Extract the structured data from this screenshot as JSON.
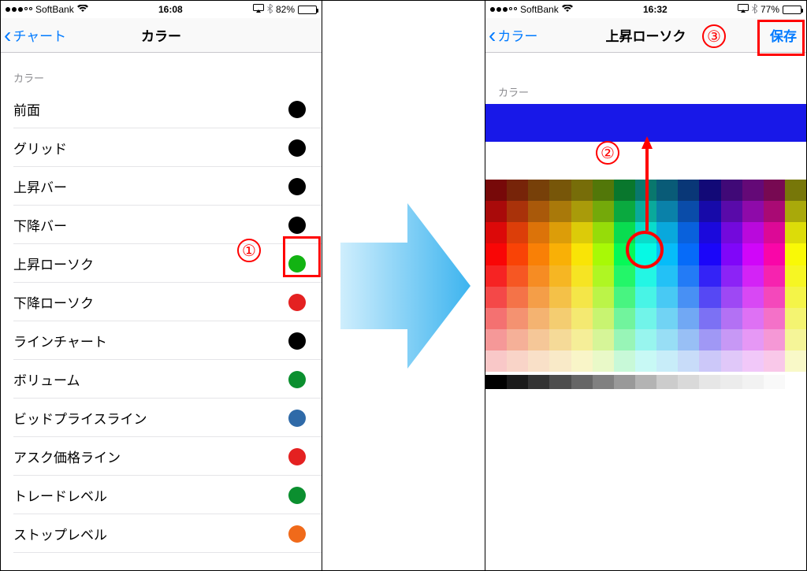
{
  "left": {
    "status": {
      "carrier": "SoftBank",
      "time": "16:08",
      "battery_pct": "82%"
    },
    "nav": {
      "back": "チャート",
      "title": "カラー"
    },
    "section": "カラー",
    "rows": [
      {
        "label": "前面",
        "color": "#000000"
      },
      {
        "label": "グリッド",
        "color": "#000000"
      },
      {
        "label": "上昇バー",
        "color": "#000000"
      },
      {
        "label": "下降バー",
        "color": "#000000"
      },
      {
        "label": "上昇ローソク",
        "color": "#12b312"
      },
      {
        "label": "下降ローソク",
        "color": "#e42121"
      },
      {
        "label": "ラインチャート",
        "color": "#000000"
      },
      {
        "label": "ボリューム",
        "color": "#0b8f2f"
      },
      {
        "label": "ビッドプライスライン",
        "color": "#2f6aa8"
      },
      {
        "label": "アスク価格ライン",
        "color": "#e42121"
      },
      {
        "label": "トレードレベル",
        "color": "#0b8f2f"
      },
      {
        "label": "ストップレベル",
        "color": "#f06a1a"
      }
    ]
  },
  "right": {
    "status": {
      "carrier": "SoftBank",
      "time": "16:32",
      "battery_pct": "77%"
    },
    "nav": {
      "back": "カラー",
      "title": "上昇ローソク",
      "save": "保存"
    },
    "section": "カラー",
    "selected_color": "#1818e8"
  },
  "annotations": {
    "step1": "①",
    "step2": "②",
    "step3": "③"
  },
  "palette_grays": [
    "#000000",
    "#1a1a1a",
    "#333333",
    "#4d4d4d",
    "#666666",
    "#808080",
    "#999999",
    "#b3b3b3",
    "#cccccc",
    "#d9d9d9",
    "#e6e6e6",
    "#ececec",
    "#f2f2f2",
    "#f9f9f9",
    "#ffffff"
  ]
}
